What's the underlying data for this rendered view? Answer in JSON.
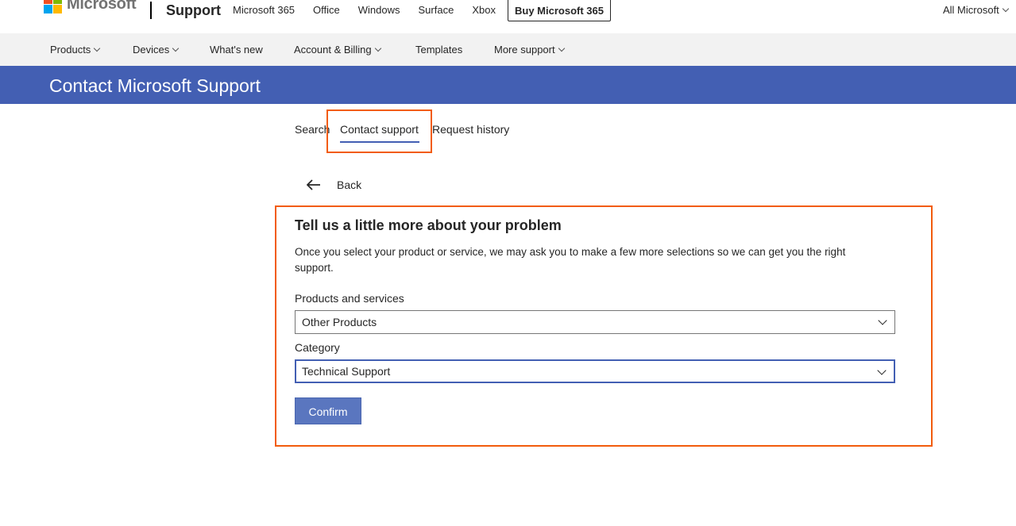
{
  "header": {
    "logo_text": "Microsoft",
    "logo_colors": [
      "#f25022",
      "#7fba00",
      "#00a4ef",
      "#ffb900"
    ],
    "brand": "Support",
    "nav": [
      "Microsoft 365",
      "Office",
      "Windows",
      "Surface",
      "Xbox"
    ],
    "buy_button": "Buy Microsoft 365",
    "all_microsoft": "All Microsoft",
    "all_microsoft_icon": "chevron-down-icon"
  },
  "subnav": {
    "items": [
      {
        "label": "Products",
        "has_dropdown": true
      },
      {
        "label": "Devices",
        "has_dropdown": true
      },
      {
        "label": "What's new",
        "has_dropdown": false
      },
      {
        "label": "Account & Billing",
        "has_dropdown": true
      },
      {
        "label": "Templates",
        "has_dropdown": false
      },
      {
        "label": "More support",
        "has_dropdown": true
      }
    ]
  },
  "banner": {
    "title": "Contact Microsoft Support",
    "color": "#435fb3"
  },
  "tabs": {
    "search": "Search",
    "contact": "Contact support",
    "history": "Request history",
    "active": "Contact support"
  },
  "back": {
    "label": "Back",
    "icon": "arrow-left-icon"
  },
  "form": {
    "title": "Tell us a little more about your problem",
    "description": "Once you select your product or service, we may ask you to make a few more selections so we can get you the right support.",
    "products_label": "Products and services",
    "products_value": "Other Products",
    "category_label": "Category",
    "category_value": "Technical Support",
    "confirm": "Confirm"
  },
  "highlight_color": "#f25c0d"
}
